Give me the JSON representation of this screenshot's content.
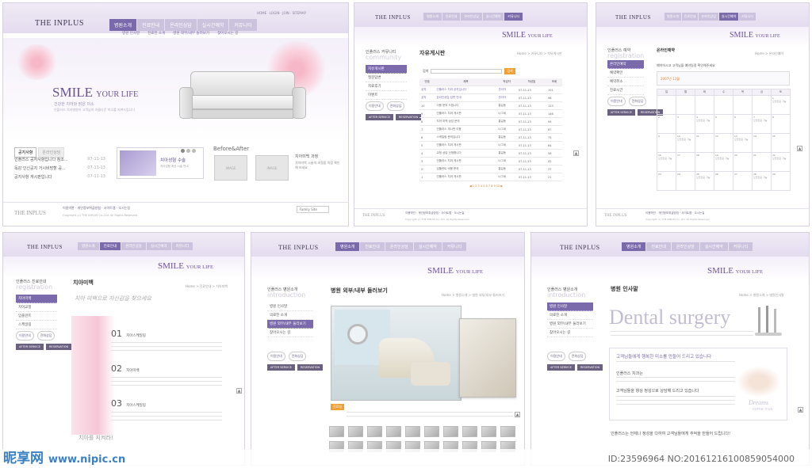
{
  "common": {
    "logo": "THE INPLUS",
    "smile": "SMILE",
    "your_life": "YOUR LIFE",
    "nav": [
      "병원소개",
      "진료안내",
      "온라인상담",
      "실시간예약",
      "커뮤니티"
    ],
    "util": "HOME · LOGIN · JOIN · SITEMAP",
    "after_service": "AFTER SERVICE",
    "reservation": "RESERVATION",
    "btn_counsel": "이용안내",
    "btn_phone": "전화상담",
    "footer_links": "이용약관 · 개인정보취급방침 · 사이트맵 · 오시는길",
    "footer_info": "Copyright (c) THE INPLUS Co.,Ltd. All Rights Reserved",
    "family_site": "Family Site"
  },
  "main_page": {
    "subnav": [
      "병원 인사말",
      "진료진 소개",
      "병원 외부/내부 둘러보기",
      "찾아오시는 길"
    ],
    "tagline": "건강한 치아와 밝은 미소",
    "tagline_en": "인플러스 치과병원이 고객님의 아름다운 미소를 지켜드립니다",
    "notice_tabs": [
      "공지사항",
      "온라인상담"
    ],
    "notices": [
      {
        "title": "인플러스 공지사항입니다 참조...",
        "date": "07-11-13"
      },
      {
        "title": "독감 인신공지 거시비방할 공...",
        "date": "07-11-13"
      },
      {
        "title": "공지사항 게시판입니다",
        "date": "07-11-13"
      }
    ],
    "promo_title": "치아성형 수술",
    "promo_desc": "치아성형 최신 시술 안내",
    "ba_title": "Before&After",
    "image_label": "IMAGE",
    "clinic_title": "치아미백 과정",
    "clinic_desc": "치아미백 시술의 과정을 직접 확인해 보세요",
    "more": "more"
  },
  "board_page": {
    "side_title": "인플러스 커뮤니티",
    "side_en": "community",
    "side_menu": [
      "자유게시판",
      "질문답변",
      "치료후기",
      "이벤트"
    ],
    "page_title": "자유게시판",
    "crumb": "Home > 커뮤니티 > 자유게시판",
    "search_label": "검색",
    "write_label": "글쓰기",
    "columns": [
      "번호",
      "제목",
      "작성자",
      "작성일",
      "조회"
    ],
    "rows": [
      [
        "공지",
        "인플러스 치과 공지입니다",
        "관리자",
        "07-11-13",
        "101"
      ],
      [
        "공지",
        "온라인상담 답변 안내",
        "관리자",
        "07-11-13",
        "98"
      ],
      [
        "10",
        "이용 문의 드립니다",
        "홍길동",
        "07-11-13",
        "123"
      ],
      [
        "9",
        "인플러스 치과 게시판",
        "나그네",
        "07-11-13",
        "146"
      ],
      [
        "8",
        "치아 미백 상담 문의",
        "홍길동",
        "07-11-13",
        "94"
      ],
      [
        "7",
        "인플러스 게시판 이용",
        "나그네",
        "07-11-13",
        "87"
      ],
      [
        "6",
        "스케일링 문의입니다",
        "홍길동",
        "07-11-13",
        "75"
      ],
      [
        "5",
        "인플러스 치과 게시판",
        "나그네",
        "07-11-13",
        "64"
      ],
      [
        "4",
        "교정 상담 신청합니다",
        "홍길동",
        "07-11-13",
        "58"
      ],
      [
        "3",
        "인플러스 치과 게시판",
        "나그네",
        "07-11-13",
        "42"
      ],
      [
        "2",
        "임플란트 비용 문의",
        "홍길동",
        "07-11-13",
        "37"
      ],
      [
        "1",
        "인플러스 치과 게시판",
        "나그네",
        "07-11-13",
        "21"
      ]
    ],
    "pager": "◀ 1 2 3 4 5 6 7 8 9 10 ▶"
  },
  "reserve_page": {
    "side_title": "인플러스 예약",
    "side_en": "registration",
    "side_menu": [
      "온라인예약",
      "예약확인",
      "예약취소",
      "진료시간"
    ],
    "page_title": "온라인예약",
    "crumb": "Home > 온라인예약",
    "intro": "예약하시고 고객님을 예약일정 확인해주세요",
    "year_month": "2007년 12월",
    "weekdays": [
      "일",
      "월",
      "화",
      "수",
      "목",
      "금",
      "토"
    ],
    "day_note": "오전진료 가능"
  },
  "whitening_page": {
    "side_title": "인플러스 진료안내",
    "side_en": "registration",
    "side_menu": [
      "치아미백",
      "치아교정",
      "임플란트",
      "스케일링"
    ],
    "page_title": "치아미백",
    "crumb": "Home > 진료안내 > 치아미백",
    "script": "치아 미백으로 자신감을 찾으세요",
    "steps": [
      {
        "num": "01",
        "title": "치아스케일링"
      },
      {
        "num": "02",
        "title": "치아미백"
      },
      {
        "num": "03",
        "title": "치아스케일링"
      }
    ],
    "caption": "치아를 지켜라!"
  },
  "tour_page": {
    "side_title": "인플러스 병원소개",
    "side_en": "introduction",
    "side_menu": [
      "병원 인사말",
      "의료진 소개",
      "병원 외부/내부 둘러보기",
      "찾아오시는 길"
    ],
    "active": 2,
    "page_title": "병원 외부/내부 둘러보기",
    "crumb": "Home > 병원소개 > 병원 외부/내부 둘러보기",
    "thumb_label": "진료실"
  },
  "greeting_page": {
    "side_title": "인플러스 병원소개",
    "side_en": "introduction",
    "side_menu": [
      "병원 인사말",
      "의료진 소개",
      "병원 외부/내부 둘러보기",
      "찾아오시는 길"
    ],
    "active": 0,
    "page_title": "병원 인사말",
    "crumb": "Home > 병원소개 > 병원인사말",
    "big_title": "Dental surgery",
    "greet1": "고객님들에게 행복한 미소를 만들어 드리고 있습니다",
    "greet2": "인플러스 치과는",
    "greet3": "고객님들을 항상 정성으로 상담해 드리고 있습니다",
    "dreams": "Dreams",
    "come_true": "come true",
    "closing": "인플러스는 언제나 정성을 다하여 고객님들에게 추억을 만들어 드립니다!"
  },
  "watermark": {
    "site": "昵享网",
    "url": "www.nipic.cn",
    "id": "ID:23596964 NO:20161216100859054000"
  }
}
